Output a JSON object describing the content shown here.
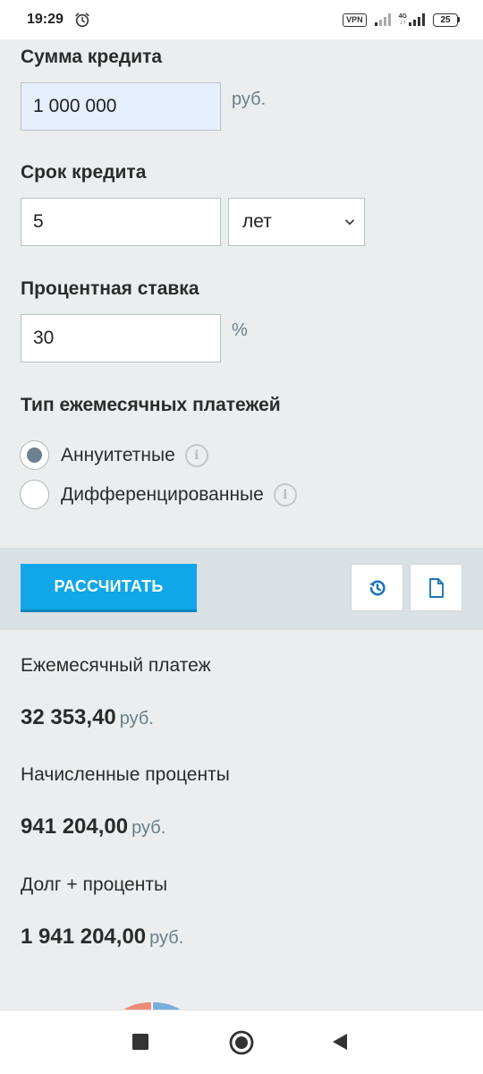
{
  "status_bar": {
    "time": "19:29",
    "vpn": "VPN",
    "network_top": "4G",
    "network_bottom": "↓↑",
    "battery": "25"
  },
  "form": {
    "amount": {
      "label": "Сумма кредита",
      "value": "1 000 000",
      "unit": "руб."
    },
    "term": {
      "label": "Срок кредита",
      "value": "5",
      "unit_selected": "лет"
    },
    "rate": {
      "label": "Процентная ставка",
      "value": "30",
      "unit": "%"
    },
    "payment_type": {
      "label": "Тип ежемесячных платежей",
      "options": [
        {
          "label": "Аннуитетные",
          "selected": true
        },
        {
          "label": "Дифференцированные",
          "selected": false
        }
      ]
    }
  },
  "actions": {
    "calculate_label": "РАССЧИТАТЬ",
    "reset_icon": "history-icon",
    "export_icon": "document-icon"
  },
  "results": {
    "monthly": {
      "label": "Ежемесячный платеж",
      "value": "32 353,40",
      "currency": "руб."
    },
    "interest": {
      "label": "Начисленные проценты",
      "value": "941 204,00",
      "currency": "руб."
    },
    "total": {
      "label": "Долг + проценты",
      "value": "1 941 204,00",
      "currency": "руб."
    }
  },
  "colors": {
    "accent": "#0fa7e8",
    "pie_interest": "#f08a78",
    "pie_principal": "#7aaedc"
  }
}
